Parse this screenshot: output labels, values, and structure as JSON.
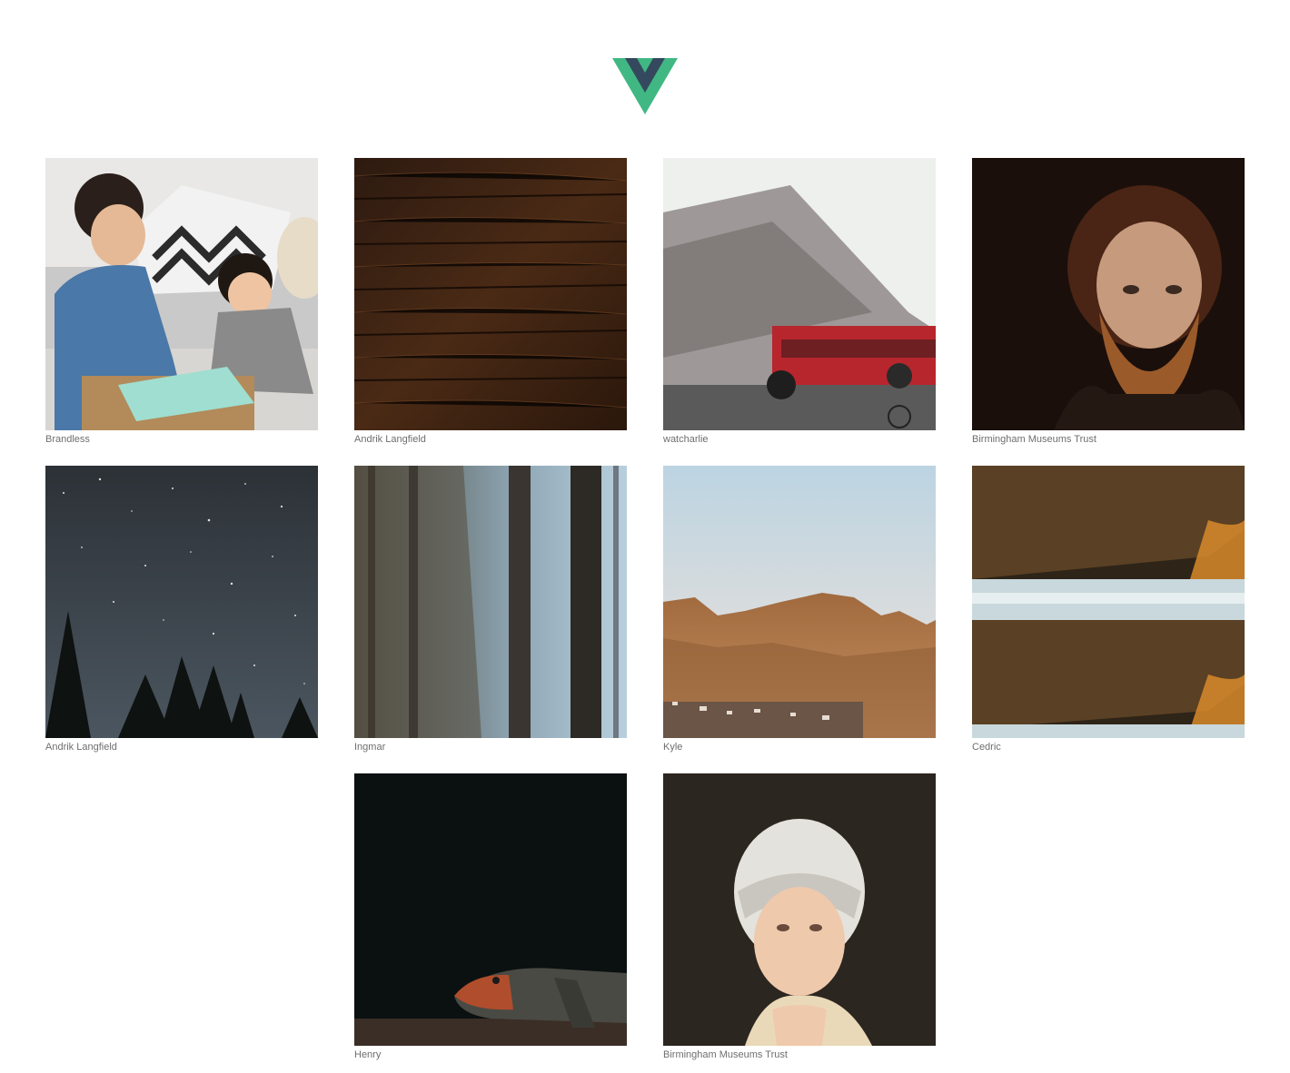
{
  "app": {
    "logo_icon": "vue-logo-icon"
  },
  "colors": {
    "vue_green": "#41b883",
    "vue_navy": "#35495e",
    "credit_text": "#6e6e6e"
  },
  "gallery": {
    "items": [
      {
        "author": "Brandless",
        "scene": "mother-and-baby-unboxing"
      },
      {
        "author": "Andrik Langfield",
        "scene": "dark-wood-floor"
      },
      {
        "author": "watcharlie",
        "scene": "motion-blur-street-bus"
      },
      {
        "author": "Birmingham Museums Trust",
        "scene": "bearded-man-portrait"
      },
      {
        "author": "Andrik Langfield",
        "scene": "starry-night-pines"
      },
      {
        "author": "Ingmar",
        "scene": "misty-forest"
      },
      {
        "author": "Kyle",
        "scene": "table-mountain"
      },
      {
        "author": "Cedric",
        "scene": "rock-cliff-mist"
      },
      {
        "author": "Henry",
        "scene": "lizard-on-log"
      },
      {
        "author": "Birmingham Museums Trust",
        "scene": "turbaned-woman-portrait"
      }
    ]
  }
}
